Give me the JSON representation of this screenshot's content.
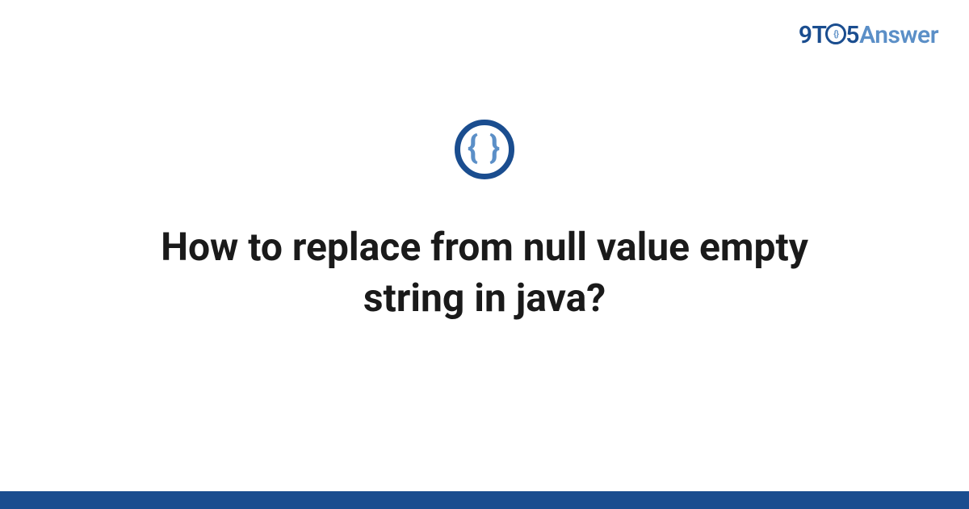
{
  "logo": {
    "part1": "9T",
    "part2": "5",
    "part3": "Answer"
  },
  "icon": {
    "braces": "{ }"
  },
  "title": "How to replace from null value empty string in java?",
  "colors": {
    "primary": "#1a4d8f",
    "secondary": "#5b8fc7",
    "text": "#1a1a1a"
  }
}
